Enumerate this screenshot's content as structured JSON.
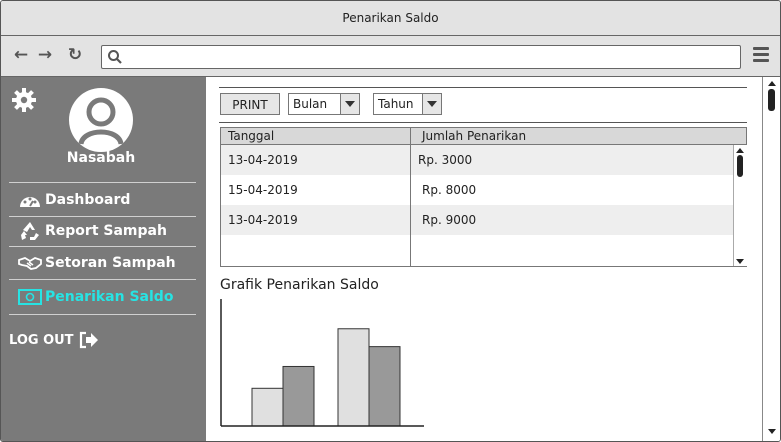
{
  "window": {
    "title": "Penarikan Saldo"
  },
  "browser": {
    "url": ""
  },
  "sidebar": {
    "username": "Nasabah",
    "items": [
      {
        "label": "Dashboard",
        "icon": "dashboard-gauge-icon"
      },
      {
        "label": "Report Sampah",
        "icon": "recycle-icon"
      },
      {
        "label": "Setoran Sampah",
        "icon": "handshake-icon"
      },
      {
        "label": "Penarikan Saldo",
        "icon": "money-icon",
        "active": true
      }
    ],
    "logout_label": "LOG OUT",
    "active_color": "#27e3e3"
  },
  "toolbar": {
    "print_label": "PRINT",
    "month_select": "Bulan",
    "year_select": "Tahun"
  },
  "table": {
    "columns": [
      "Tanggal",
      "Jumlah Penarikan"
    ],
    "rows": [
      [
        "13-04-2019",
        "Rp. 3000"
      ],
      [
        "15-04-2019",
        "Rp. 8000"
      ],
      [
        "13-04-2019",
        "Rp. 9000"
      ]
    ]
  },
  "chart_section": {
    "title": "Grafik Penarikan Saldo"
  },
  "chart_data": {
    "type": "bar",
    "categories": [
      "",
      ""
    ],
    "series": [
      {
        "name": "",
        "values": [
          38,
          98
        ],
        "color": "#e0e0e0"
      },
      {
        "name": "",
        "values": [
          60,
          80
        ],
        "color": "#999999"
      }
    ],
    "ylim": [
      0,
      128
    ],
    "grid": false
  }
}
